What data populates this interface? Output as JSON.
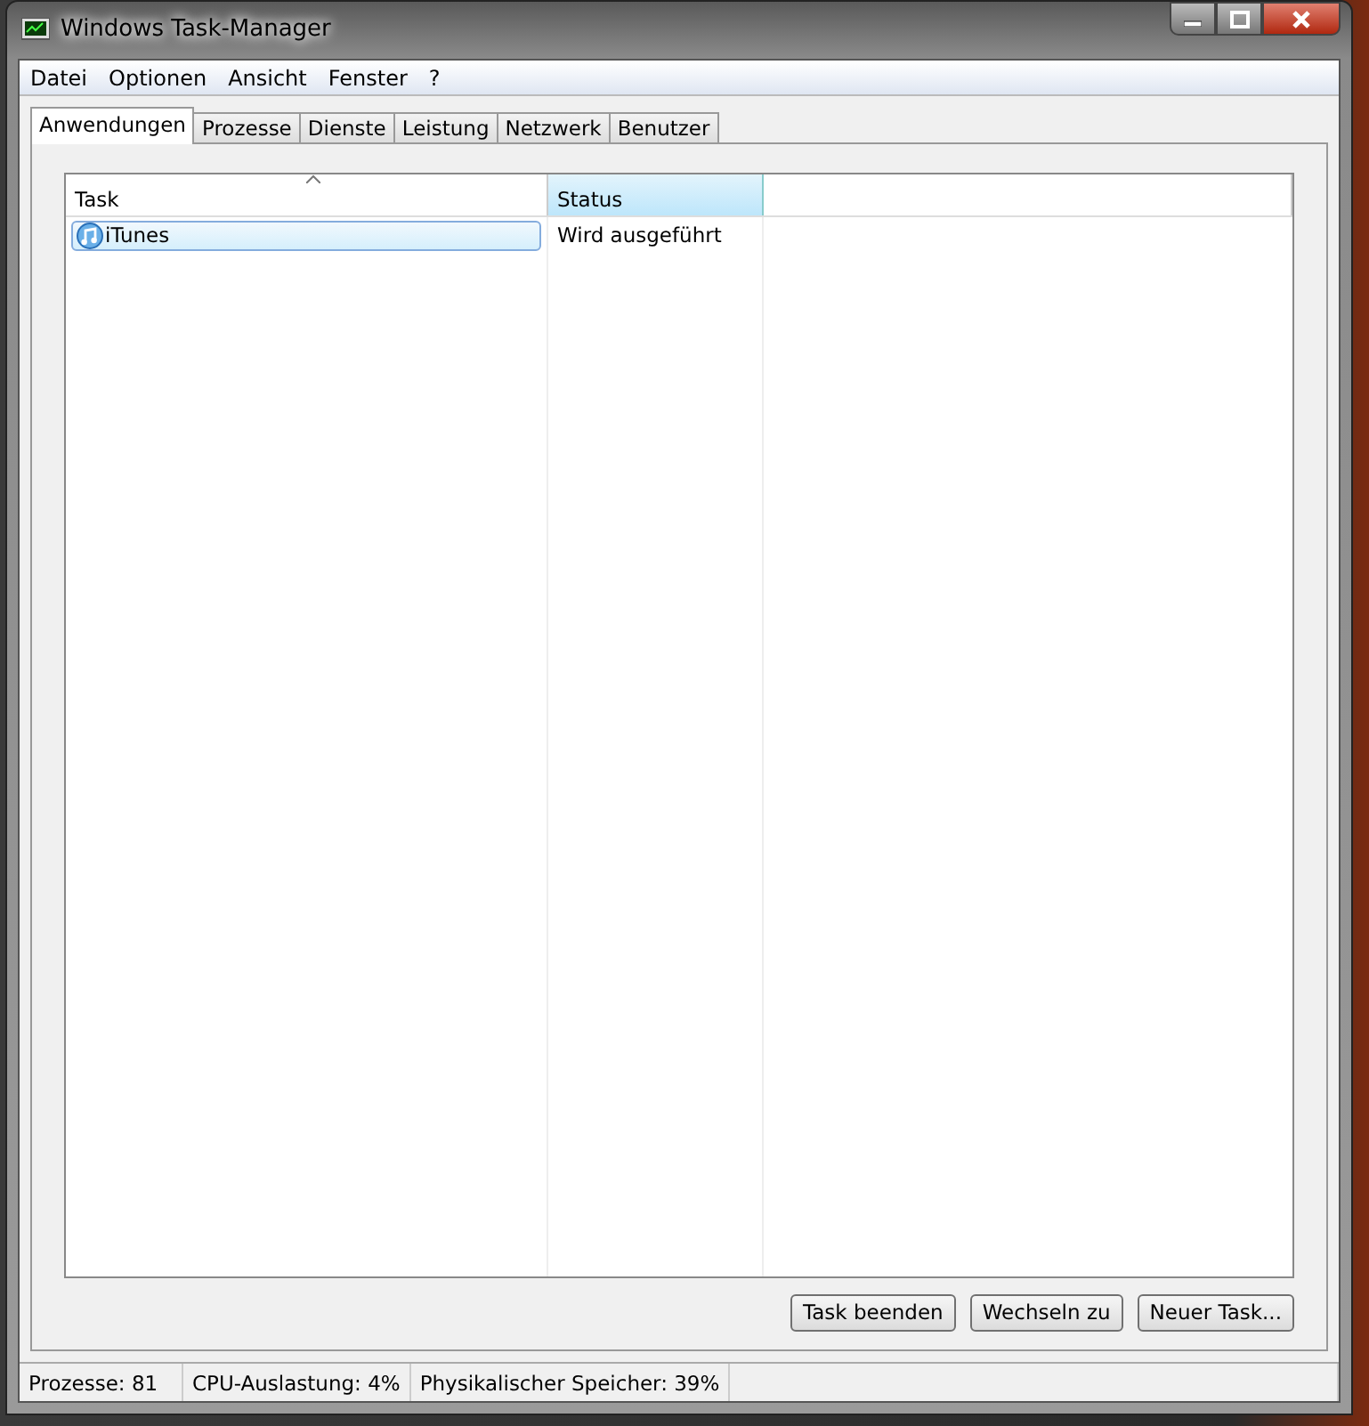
{
  "window": {
    "title": "Windows Task-Manager"
  },
  "menu": [
    "Datei",
    "Optionen",
    "Ansicht",
    "Fenster",
    "?"
  ],
  "tabs": [
    {
      "label": "Anwendungen",
      "selected": true
    },
    {
      "label": "Prozesse",
      "selected": false
    },
    {
      "label": "Dienste",
      "selected": false
    },
    {
      "label": "Leistung",
      "selected": false
    },
    {
      "label": "Netzwerk",
      "selected": false
    },
    {
      "label": "Benutzer",
      "selected": false
    }
  ],
  "table": {
    "columns": [
      {
        "label": "Task",
        "sorted": true,
        "hot": false
      },
      {
        "label": "Status",
        "sorted": false,
        "hot": true
      }
    ],
    "rows": [
      {
        "task": "iTunes",
        "status": "Wird ausgeführt",
        "selected": true
      }
    ]
  },
  "buttons": [
    "Task beenden",
    "Wechseln zu",
    "Neuer Task..."
  ],
  "status_bar": [
    "Prozesse: 81",
    "CPU-Auslastung: 4%",
    "Physikalischer Speicher: 39%"
  ]
}
